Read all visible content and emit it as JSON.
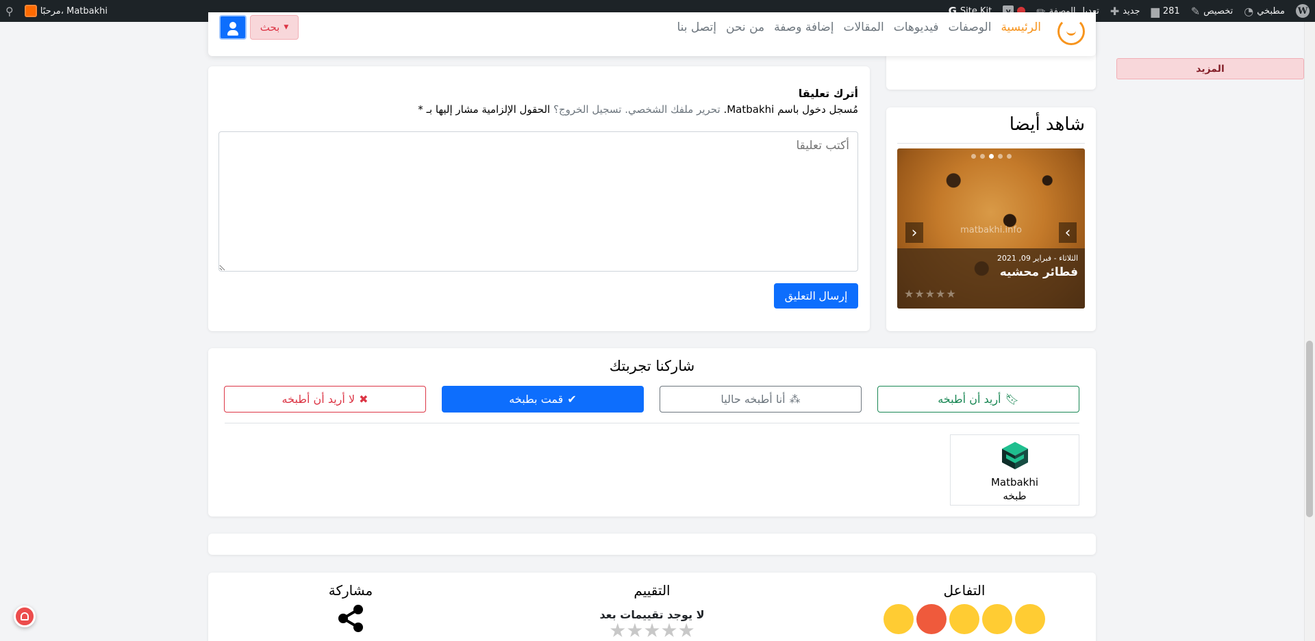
{
  "adminbar": {
    "site_name": "مطبخي",
    "customize": "تخصيص",
    "comments_count": "281",
    "new_label": "جديد",
    "edit_recipe": "تعديل الوصفة",
    "site_kit": "Site Kit",
    "greeting": "مرحبًا، Matbakhi"
  },
  "nav": {
    "links": [
      "الرئيسية",
      "الوصفات",
      "فيديوهات",
      "المقالات",
      "إضافة وصفة",
      "من نحن",
      "إتصل بنا"
    ],
    "search_label": "بحث",
    "more_label": "المزيد"
  },
  "comment": {
    "title": "أترك تعليقا",
    "logged_in_prefix": "مُسجل دخول باسم Matbakhi.",
    "edit_profile": "تحرير ملفك الشخصي.",
    "logout": "تسجيل الخروج؟",
    "required_note": "الحقول الإلزامية مشار إليها بـ *",
    "placeholder": "أكتب تعليقا",
    "submit_label": "إرسال التعليق"
  },
  "sidebar": {
    "title": "شاهد أيضا",
    "slide": {
      "date": "الثلاثاء - فبراير 09, 2021",
      "title": "فطائر محشيه",
      "watermark": "matbakhi.info",
      "rating": 0,
      "stars_max": 5
    },
    "dot_count": 5,
    "active_dot": 2
  },
  "experience": {
    "title": "شاركنا تجربتك",
    "options": [
      "أريد أن أطبخه",
      "أنا أطبخه حاليا",
      "قمت بطبخه",
      "لا أريد أن أطبخه"
    ],
    "cooked_by": {
      "name": "Matbakhi",
      "role": "طبخه"
    }
  },
  "bottom": {
    "reactions_title": "التفاعل",
    "rating_title": "التقييم",
    "no_ratings": "لا يوجد تقييمات بعد",
    "share_title": "مشاركة"
  },
  "colors": {
    "primary": "#0d6efd",
    "success": "#198754",
    "danger": "#dc3545",
    "brand": "#f7941d"
  }
}
